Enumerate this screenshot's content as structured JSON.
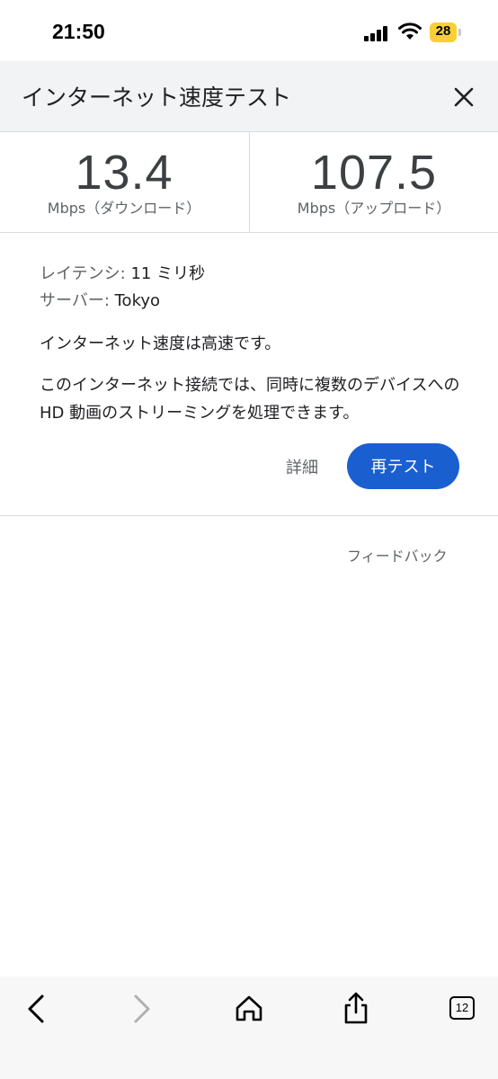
{
  "status_bar": {
    "time": "21:50",
    "battery": "28",
    "battery_color": "#f7d034"
  },
  "header": {
    "title": "インターネット速度テスト",
    "close_icon": "close-icon"
  },
  "speeds": {
    "download": {
      "value": "13.4",
      "unit": "Mbps（ダウンロード）"
    },
    "upload": {
      "value": "107.5",
      "unit": "Mbps（アップロード）"
    }
  },
  "info": {
    "latency_label": "レイテンシ:",
    "latency_value": "11 ミリ秒",
    "server_label": "サーバー:",
    "server_value": "Tokyo",
    "verdict": "インターネット速度は高速です。",
    "description": "このインターネット接続では、同時に複数のデバイスへの HD 動画のストリーミングを処理できます。"
  },
  "actions": {
    "details_label": "詳細",
    "retest_label": "再テスト",
    "accent_color": "#1a5fd0"
  },
  "feedback_label": "フィードバック",
  "toolbar": {
    "back_icon": "back-icon",
    "forward_icon": "forward-icon",
    "home_icon": "home-icon",
    "share_icon": "share-icon",
    "tabs_count": "12"
  }
}
